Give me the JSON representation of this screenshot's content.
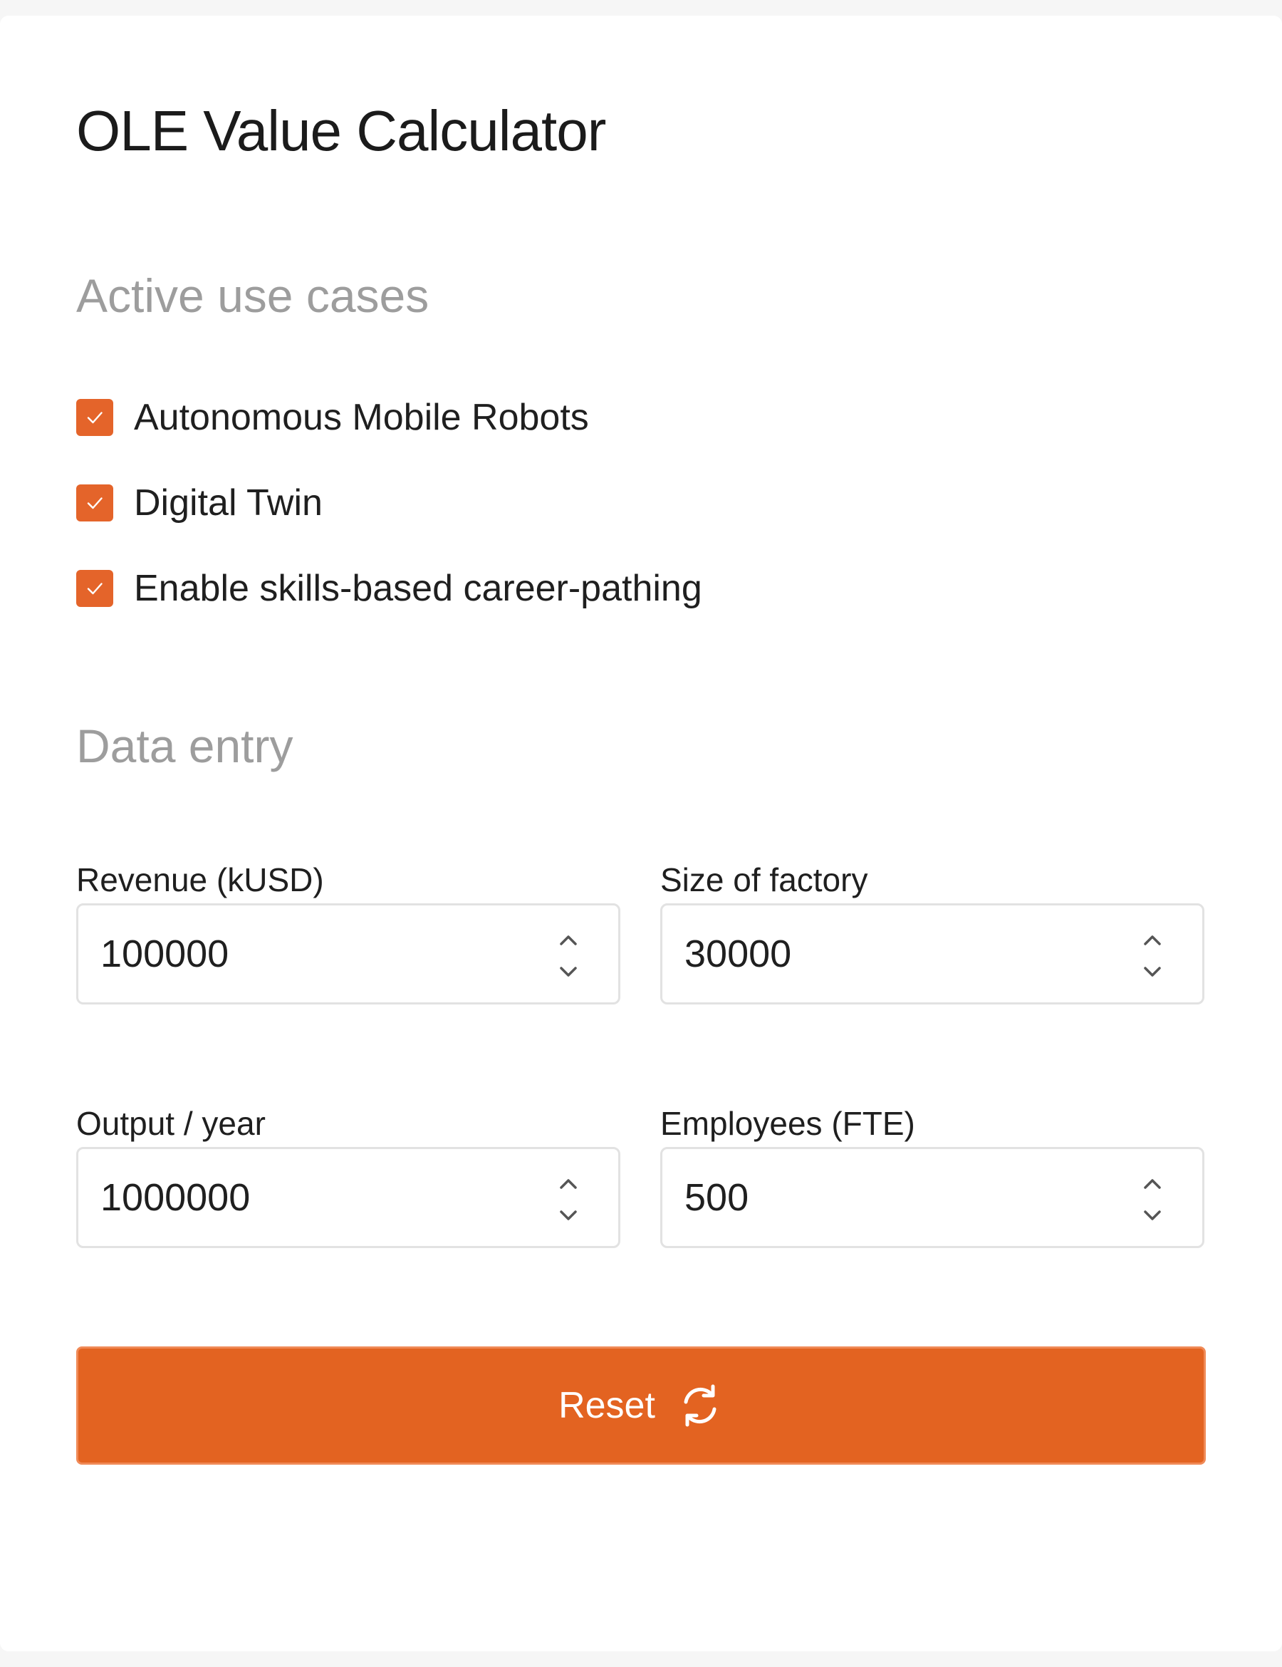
{
  "app": {
    "title": "OLE Value Calculator"
  },
  "use_cases": {
    "heading": "Active use cases",
    "items": [
      {
        "label": "Autonomous Mobile Robots",
        "checked": true
      },
      {
        "label": "Digital Twin",
        "checked": true
      },
      {
        "label": "Enable skills-based career-pathing",
        "checked": true
      }
    ]
  },
  "data_entry": {
    "heading": "Data entry",
    "fields": [
      {
        "label": "Revenue (kUSD)",
        "value": "100000"
      },
      {
        "label": "Size of factory",
        "value": "30000"
      },
      {
        "label": "Output / year",
        "value": "1000000"
      },
      {
        "label": "Employees (FTE)",
        "value": "500"
      }
    ]
  },
  "reset": {
    "label": "Reset",
    "icon": "refresh-icon"
  },
  "colors": {
    "accent": "#e36321",
    "checkbox": "#e4642a",
    "heading_muted": "#9d9d9d",
    "text": "#1f1f1f",
    "input_border": "#e2e2e2"
  }
}
